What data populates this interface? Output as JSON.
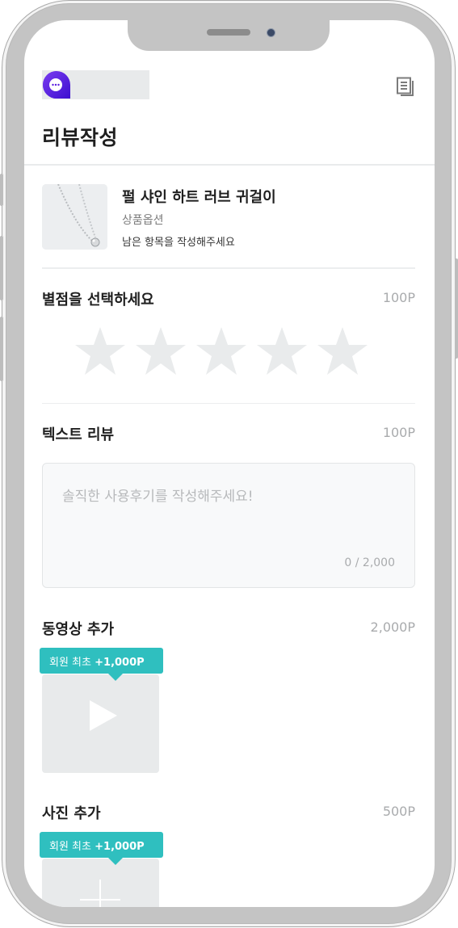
{
  "header": {
    "title": "리뷰작성"
  },
  "product": {
    "name": "펄 샤인 하트 러브 귀걸이",
    "option": "상품옵션",
    "remaining": "남은 항목을 작성해주세요"
  },
  "rating": {
    "label": "별점을 선택하세요",
    "points": "100P",
    "stars_total": 5,
    "stars_selected": 0
  },
  "text_review": {
    "label": "텍스트 리뷰",
    "points": "100P",
    "placeholder": "솔직한 사용후기를 작성해주세요!",
    "counter": "0 / 2,000"
  },
  "video": {
    "label": "동영상 추가",
    "points": "2,000P",
    "badge_prefix": "회원 최초",
    "badge_bonus": "+1,000P"
  },
  "photo": {
    "label": "사진 추가",
    "points": "500P",
    "badge_prefix": "회원 최초",
    "badge_bonus": "+1,000P"
  },
  "colors": {
    "accent": "#2fbfbf",
    "logo_purple": "#5a1ee0",
    "star_empty": "#e9ebec"
  },
  "icons": {
    "logo": "chat-bubble-logo-icon",
    "document": "document-list-icon",
    "play": "play-icon",
    "plus": "plus-icon",
    "star": "star-icon"
  }
}
